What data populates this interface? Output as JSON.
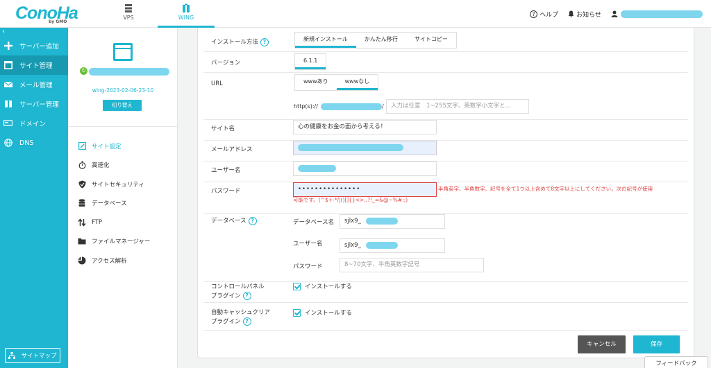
{
  "header": {
    "logo_text": "ConoHa",
    "logo_sub": "by GMO",
    "services": [
      {
        "label": "VPS"
      },
      {
        "label": "WING"
      }
    ],
    "help_label": "ヘルプ",
    "notice_label": "お知らせ"
  },
  "sidebar": {
    "collapse": "‹",
    "items": [
      {
        "label": "サーバー追加",
        "icon": "plus-icon"
      },
      {
        "label": "サイト管理",
        "icon": "site-icon"
      },
      {
        "label": "メール管理",
        "icon": "mail-icon"
      },
      {
        "label": "サーバー管理",
        "icon": "server-icon"
      },
      {
        "label": "ドメイン",
        "icon": "domain-icon"
      },
      {
        "label": "DNS",
        "icon": "globe-icon"
      }
    ],
    "sitemap_label": "サイトマップ"
  },
  "site": {
    "id": "wing-2023-02-06-23-10",
    "switch_label": "切り替え"
  },
  "subnav": [
    {
      "label": "サイト設定",
      "icon": "settings-icon"
    },
    {
      "label": "高速化",
      "icon": "stopwatch-icon"
    },
    {
      "label": "サイトセキュリティ",
      "icon": "shield-icon"
    },
    {
      "label": "データベース",
      "icon": "database-icon"
    },
    {
      "label": "FTP",
      "icon": "transfer-icon"
    },
    {
      "label": "ファイルマネージャー",
      "icon": "folder-icon"
    },
    {
      "label": "アクセス解析",
      "icon": "analytics-icon"
    }
  ],
  "form": {
    "install_method": {
      "label": "インストール方法",
      "tabs": [
        "新規インストール",
        "かんたん移行",
        "サイトコピー"
      ]
    },
    "version": {
      "label": "バージョン",
      "value": "6.1.1"
    },
    "url": {
      "label": "URL",
      "tabs": [
        "wwwあり",
        "wwwなし"
      ],
      "prefix": "http(s)://",
      "slash": "/",
      "path_placeholder": "入力は任意　1~255文字、英数字小文字と…"
    },
    "site_name": {
      "label": "サイト名",
      "value": "心の健康をお金の面から考える！"
    },
    "email": {
      "label": "メールアドレス"
    },
    "username": {
      "label": "ユーザー名"
    },
    "password": {
      "label": "パスワード",
      "value": "•••••••••••••••",
      "error_line1": "半角英字、半角数字、記号を全て1つ以上含めて8文字以上にしてください。次の記号が使用",
      "error_line2": "可能です。(^$+-*/|()[]{}<>.,?!_=&@~%#:;)"
    },
    "database": {
      "label": "データベース",
      "db_name_label": "データベース名",
      "db_prefix": "sjlx9_",
      "user_label": "ユーザー名",
      "user_prefix": "sjlx9_",
      "pass_label": "パスワード",
      "pass_placeholder": "8~70文字、半角英数字記号"
    },
    "control_panel": {
      "label_line1": "コントロールパネル",
      "label_line2": "プラグイン",
      "option": "インストールする"
    },
    "auto_cache": {
      "label_line1": "自動キャッシュクリア",
      "label_line2": "プラグイン",
      "option": "インストールする"
    }
  },
  "actions": {
    "cancel": "キャンセル",
    "save": "保存"
  },
  "feedback": "フィードバック",
  "colors": {
    "accent": "#1eb6d0",
    "sidebar_active": "#179ab1",
    "error": "#e04444",
    "cancel_bg": "#555555",
    "redaction": "#7ed6ee"
  }
}
